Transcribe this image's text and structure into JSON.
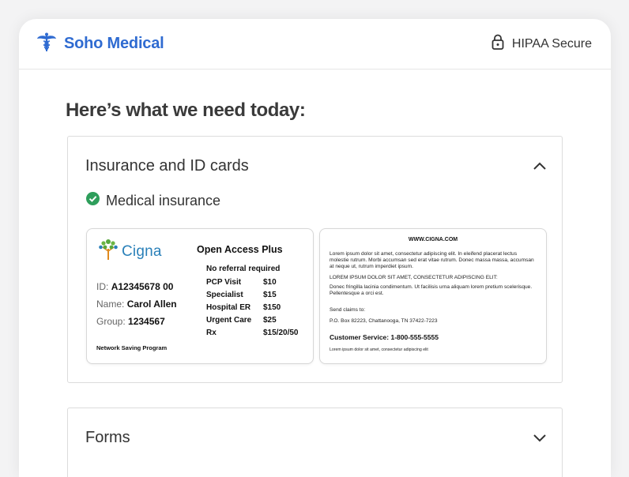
{
  "header": {
    "brand_name": "Soho Medical",
    "security_label": "HIPAA Secure",
    "brand_color": "#2f6bd1"
  },
  "main": {
    "title": "Here’s what we need today:"
  },
  "insurance_section": {
    "title": "Insurance and ID cards",
    "expanded": true,
    "status_label": "Medical insurance",
    "status_color": "#2e9e5b",
    "card_front": {
      "logo_text": "Cigna",
      "plan_name": "Open Access Plus",
      "referral_note": "No referral required",
      "id_label": "ID:",
      "id_value": "A12345678 00",
      "name_label": "Name:",
      "name_value": "Carol Allen",
      "group_label": "Group:",
      "group_value": "1234567",
      "copays": [
        {
          "label": "PCP Visit",
          "value": "$10"
        },
        {
          "label": "Specialist",
          "value": "$15"
        },
        {
          "label": "Hospital ER",
          "value": "$150"
        },
        {
          "label": "Urgent Care",
          "value": "$25"
        },
        {
          "label": "Rx",
          "value": "$15/20/50"
        }
      ],
      "network_note": "Network Saving Program"
    },
    "card_back": {
      "website": "WWW.CIGNA.COM",
      "paragraph_1": "Lorem ipsum dolor sit amet, consectetur adipiscing elit. In eleifend placerat lectus molestie rutrum. Morbi accumsan sed erat vitae rutrum. Donec massa massa, accumsan at neque ut, rutrum imperdiet ipsum.",
      "paragraph_2": "LOREM IPSUM DOLOR SIT AMET, CONSECTETUR ADIPISCING ELIT:",
      "paragraph_3": "Donec fringilla lacinia condimentum. Ut facilisis urna aliquam lorem pretium scelerisque. Pellentesque a orci est.",
      "send_claims_label": "Send claims to:",
      "address": "P.O. Box 82223, Chattanooga, TN 37422-7223",
      "customer_service": "Customer Service: 1-800-555-5555",
      "footer_text": "Lorem ipsum dolor sit amet, consectetur adipiscing elit"
    }
  },
  "forms_section": {
    "title": "Forms",
    "expanded": false
  },
  "icons": {
    "brand": "caduceus-icon",
    "security": "lock-icon",
    "collapse": "chevron-up-icon",
    "expand": "chevron-down-icon",
    "status": "check-circle-icon",
    "card_logo": "cigna-tree-icon"
  }
}
